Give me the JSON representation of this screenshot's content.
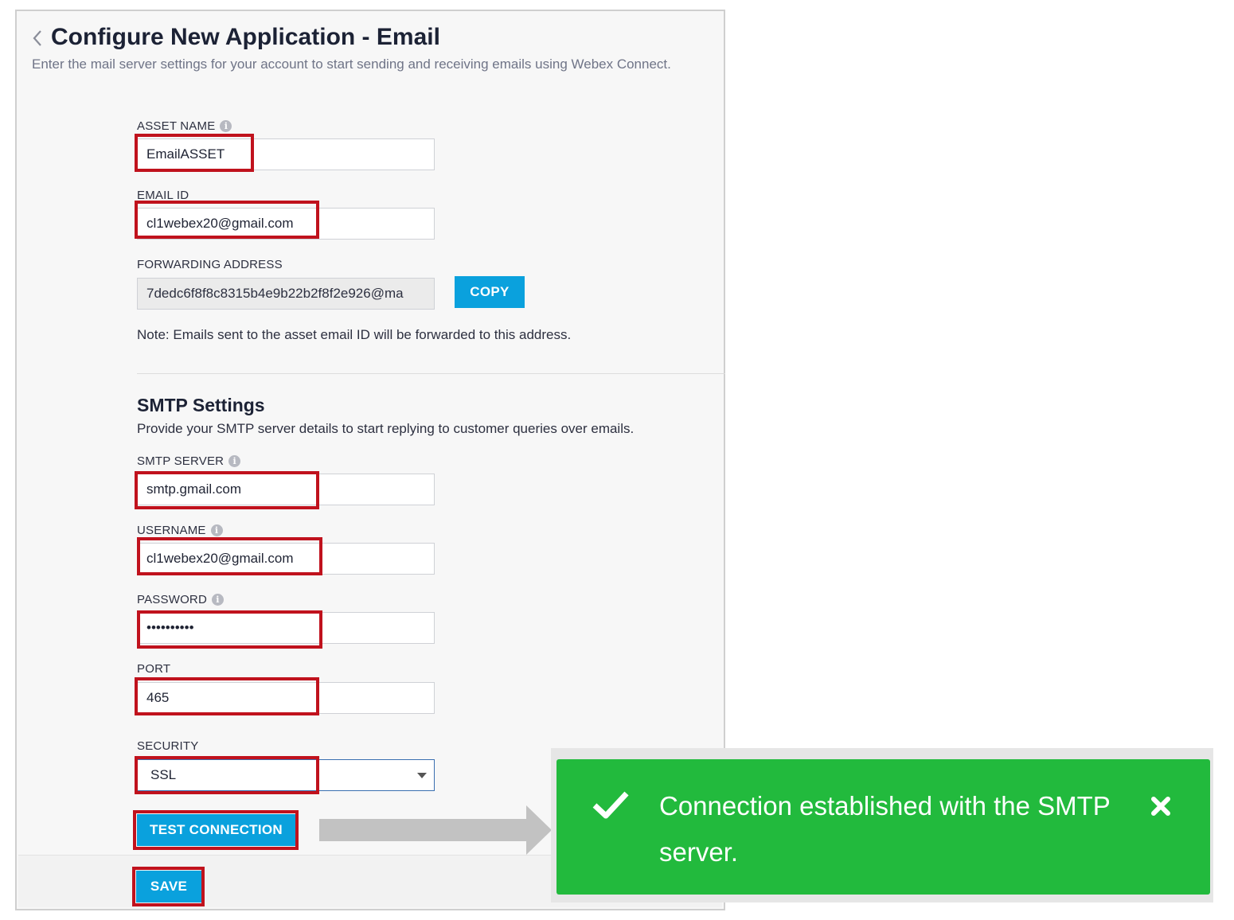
{
  "header": {
    "title": "Configure New Application - Email",
    "subtitle": "Enter the mail server settings for your account to start sending and receiving emails using Webex Connect."
  },
  "icons": {
    "back": "chevron-left-icon",
    "info": "info-icon",
    "dropdown": "caret-down-icon",
    "success": "check-icon",
    "close": "close-icon"
  },
  "fields": {
    "asset_name": {
      "label": "ASSET NAME",
      "value": "EmailASSET"
    },
    "email_id": {
      "label": "EMAIL ID",
      "value": "cl1webex20@gmail.com"
    },
    "forwarding_address": {
      "label": "FORWARDING ADDRESS",
      "value": "7dedc6f8f8c8315b4e9b22b2f8f2e926@ma"
    }
  },
  "copy_button": "COPY",
  "note": "Note: Emails sent to the asset email ID will be forwarded to this address.",
  "smtp": {
    "title": "SMTP Settings",
    "description": "Provide your SMTP server details to start replying to customer queries over emails.",
    "server": {
      "label": "SMTP SERVER",
      "value": "smtp.gmail.com"
    },
    "username": {
      "label": "USERNAME",
      "value": "cl1webex20@gmail.com"
    },
    "password": {
      "label": "PASSWORD",
      "value": "••••••••••"
    },
    "port": {
      "label": "PORT",
      "value": "465"
    },
    "security": {
      "label": "SECURITY",
      "value": "SSL"
    }
  },
  "buttons": {
    "test_connection": "TEST CONNECTION",
    "save": "SAVE"
  },
  "toast": {
    "message": "Connection established with the SMTP server."
  },
  "colors": {
    "accent": "#0aa1dd",
    "highlight": "#c0121d",
    "success": "#22ba3d"
  }
}
